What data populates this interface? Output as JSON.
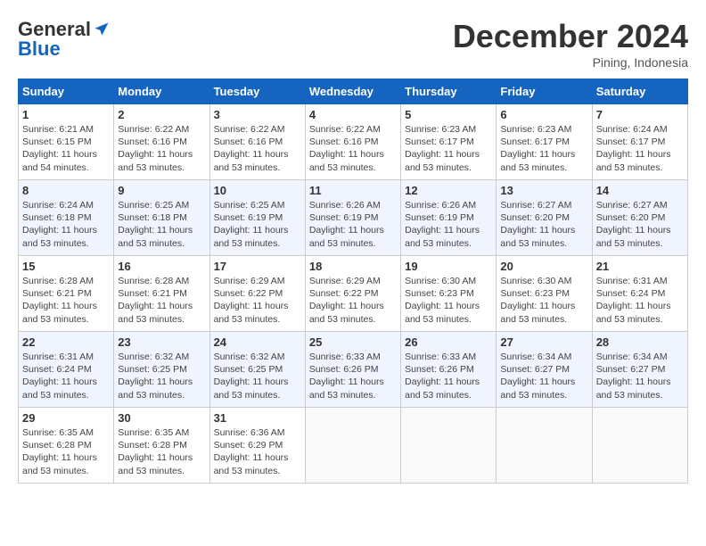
{
  "header": {
    "logo_line1": "General",
    "logo_line2": "Blue",
    "month": "December 2024",
    "location": "Pining, Indonesia"
  },
  "weekdays": [
    "Sunday",
    "Monday",
    "Tuesday",
    "Wednesday",
    "Thursday",
    "Friday",
    "Saturday"
  ],
  "weeks": [
    [
      {
        "day": "1",
        "sunrise": "6:21 AM",
        "sunset": "6:15 PM",
        "daylight": "11 hours and 54 minutes."
      },
      {
        "day": "2",
        "sunrise": "6:22 AM",
        "sunset": "6:16 PM",
        "daylight": "11 hours and 53 minutes."
      },
      {
        "day": "3",
        "sunrise": "6:22 AM",
        "sunset": "6:16 PM",
        "daylight": "11 hours and 53 minutes."
      },
      {
        "day": "4",
        "sunrise": "6:22 AM",
        "sunset": "6:16 PM",
        "daylight": "11 hours and 53 minutes."
      },
      {
        "day": "5",
        "sunrise": "6:23 AM",
        "sunset": "6:17 PM",
        "daylight": "11 hours and 53 minutes."
      },
      {
        "day": "6",
        "sunrise": "6:23 AM",
        "sunset": "6:17 PM",
        "daylight": "11 hours and 53 minutes."
      },
      {
        "day": "7",
        "sunrise": "6:24 AM",
        "sunset": "6:17 PM",
        "daylight": "11 hours and 53 minutes."
      }
    ],
    [
      {
        "day": "8",
        "sunrise": "6:24 AM",
        "sunset": "6:18 PM",
        "daylight": "11 hours and 53 minutes."
      },
      {
        "day": "9",
        "sunrise": "6:25 AM",
        "sunset": "6:18 PM",
        "daylight": "11 hours and 53 minutes."
      },
      {
        "day": "10",
        "sunrise": "6:25 AM",
        "sunset": "6:19 PM",
        "daylight": "11 hours and 53 minutes."
      },
      {
        "day": "11",
        "sunrise": "6:26 AM",
        "sunset": "6:19 PM",
        "daylight": "11 hours and 53 minutes."
      },
      {
        "day": "12",
        "sunrise": "6:26 AM",
        "sunset": "6:19 PM",
        "daylight": "11 hours and 53 minutes."
      },
      {
        "day": "13",
        "sunrise": "6:27 AM",
        "sunset": "6:20 PM",
        "daylight": "11 hours and 53 minutes."
      },
      {
        "day": "14",
        "sunrise": "6:27 AM",
        "sunset": "6:20 PM",
        "daylight": "11 hours and 53 minutes."
      }
    ],
    [
      {
        "day": "15",
        "sunrise": "6:28 AM",
        "sunset": "6:21 PM",
        "daylight": "11 hours and 53 minutes."
      },
      {
        "day": "16",
        "sunrise": "6:28 AM",
        "sunset": "6:21 PM",
        "daylight": "11 hours and 53 minutes."
      },
      {
        "day": "17",
        "sunrise": "6:29 AM",
        "sunset": "6:22 PM",
        "daylight": "11 hours and 53 minutes."
      },
      {
        "day": "18",
        "sunrise": "6:29 AM",
        "sunset": "6:22 PM",
        "daylight": "11 hours and 53 minutes."
      },
      {
        "day": "19",
        "sunrise": "6:30 AM",
        "sunset": "6:23 PM",
        "daylight": "11 hours and 53 minutes."
      },
      {
        "day": "20",
        "sunrise": "6:30 AM",
        "sunset": "6:23 PM",
        "daylight": "11 hours and 53 minutes."
      },
      {
        "day": "21",
        "sunrise": "6:31 AM",
        "sunset": "6:24 PM",
        "daylight": "11 hours and 53 minutes."
      }
    ],
    [
      {
        "day": "22",
        "sunrise": "6:31 AM",
        "sunset": "6:24 PM",
        "daylight": "11 hours and 53 minutes."
      },
      {
        "day": "23",
        "sunrise": "6:32 AM",
        "sunset": "6:25 PM",
        "daylight": "11 hours and 53 minutes."
      },
      {
        "day": "24",
        "sunrise": "6:32 AM",
        "sunset": "6:25 PM",
        "daylight": "11 hours and 53 minutes."
      },
      {
        "day": "25",
        "sunrise": "6:33 AM",
        "sunset": "6:26 PM",
        "daylight": "11 hours and 53 minutes."
      },
      {
        "day": "26",
        "sunrise": "6:33 AM",
        "sunset": "6:26 PM",
        "daylight": "11 hours and 53 minutes."
      },
      {
        "day": "27",
        "sunrise": "6:34 AM",
        "sunset": "6:27 PM",
        "daylight": "11 hours and 53 minutes."
      },
      {
        "day": "28",
        "sunrise": "6:34 AM",
        "sunset": "6:27 PM",
        "daylight": "11 hours and 53 minutes."
      }
    ],
    [
      {
        "day": "29",
        "sunrise": "6:35 AM",
        "sunset": "6:28 PM",
        "daylight": "11 hours and 53 minutes."
      },
      {
        "day": "30",
        "sunrise": "6:35 AM",
        "sunset": "6:28 PM",
        "daylight": "11 hours and 53 minutes."
      },
      {
        "day": "31",
        "sunrise": "6:36 AM",
        "sunset": "6:29 PM",
        "daylight": "11 hours and 53 minutes."
      },
      null,
      null,
      null,
      null
    ]
  ]
}
